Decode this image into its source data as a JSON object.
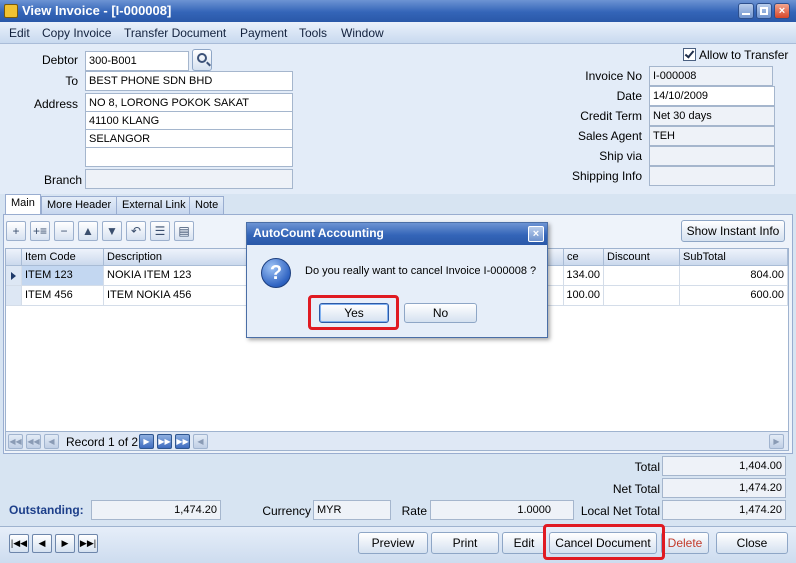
{
  "window": {
    "title": "View Invoice - [I-000008]"
  },
  "menu": [
    "Edit",
    "Copy Invoice",
    "Transfer Document",
    "Payment",
    "Tools",
    "Window"
  ],
  "header": {
    "allow_transfer_label": "Allow to Transfer",
    "allow_transfer_checked": true,
    "debtor_label": "Debtor",
    "debtor_value": "300-B001",
    "to_label": "To",
    "to_value": "BEST PHONE SDN BHD",
    "address_label": "Address",
    "address_lines": [
      "NO 8, LORONG POKOK SAKAT",
      "41100 KLANG",
      "SELANGOR",
      ""
    ],
    "branch_label": "Branch",
    "branch_value": "",
    "invoice_no_label": "Invoice No",
    "invoice_no_value": "I-000008",
    "date_label": "Date",
    "date_value": "14/10/2009",
    "credit_term_label": "Credit Term",
    "credit_term_value": "Net 30 days",
    "sales_agent_label": "Sales Agent",
    "sales_agent_value": "TEH",
    "ship_via_label": "Ship via",
    "ship_via_value": "",
    "shipping_info_label": "Shipping Info",
    "shipping_info_value": ""
  },
  "tabs": [
    "Main",
    "More Header",
    "External Link",
    "Note"
  ],
  "toolbar": {
    "show_instant_info": "Show Instant Info"
  },
  "grid": {
    "headers": {
      "item_code": "Item Code",
      "description": "Description",
      "price": "ce",
      "discount": "Discount",
      "subtotal": "SubTotal"
    },
    "rows": [
      {
        "item_code": "ITEM 123",
        "description": "NOKIA ITEM 123",
        "price": "134.00",
        "discount": "",
        "subtotal": "804.00"
      },
      {
        "item_code": "ITEM 456",
        "description": "ITEM NOKIA 456",
        "price": "100.00",
        "discount": "",
        "subtotal": "600.00"
      }
    ],
    "record_text": "Record 1 of 2"
  },
  "dialog": {
    "title": "AutoCount Accounting",
    "message": "Do you really want to cancel Invoice I-000008 ?",
    "yes_label": "Yes",
    "no_label": "No"
  },
  "totals": {
    "total_label": "Total",
    "total_value": "1,404.00",
    "net_total_label": "Net Total",
    "net_total_value": "1,474.20",
    "local_net_total_label": "Local Net Total",
    "local_net_total_value": "1,474.20",
    "outstanding_label": "Outstanding:",
    "outstanding_value": "1,474.20",
    "currency_label": "Currency",
    "currency_value": "MYR",
    "rate_label": "Rate",
    "rate_value": "1.0000"
  },
  "buttons": {
    "preview": "Preview",
    "print": "Print",
    "edit": "Edit",
    "cancel_document": "Cancel Document",
    "delete": "Delete",
    "close": "Close"
  },
  "colors": {
    "highlight_red": "#e01a22",
    "title_blue": "#3465b8",
    "outstanding_blue": "#1d3f8a"
  }
}
